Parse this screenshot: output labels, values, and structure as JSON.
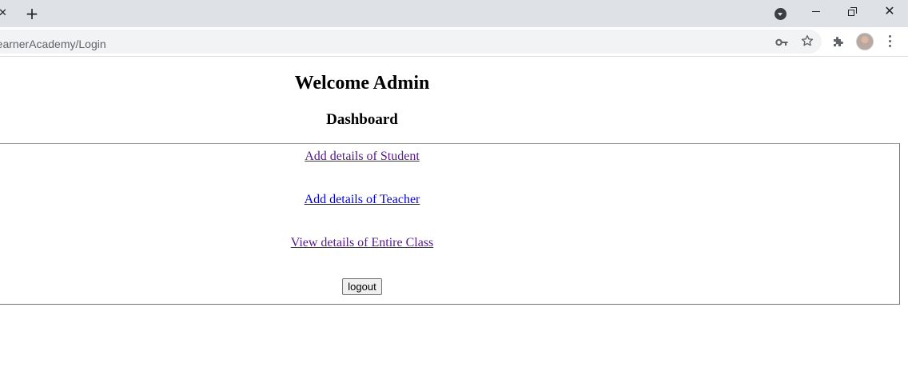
{
  "browser": {
    "tab_close_glyph": "✕",
    "new_tab_glyph": "+",
    "window_close_glyph": "✕",
    "url": "/LearnerAcademy/Login",
    "icons": [
      "tab-search-icon",
      "minimize-icon",
      "restore-icon",
      "close-icon",
      "key-icon",
      "star-icon",
      "extensions-icon",
      "avatar",
      "more-icon"
    ]
  },
  "page": {
    "welcome_heading": "Welcome Admin",
    "dashboard_heading": "Dashboard",
    "links": {
      "student": "Add details of Student",
      "teacher": "Add details of Teacher",
      "class": "View details of Entire Class"
    },
    "logout_label": "logout"
  },
  "colors": {
    "visited_link": "#551a8b",
    "unvisited_link": "#0000ee",
    "tabstrip": "#dee1e6"
  }
}
